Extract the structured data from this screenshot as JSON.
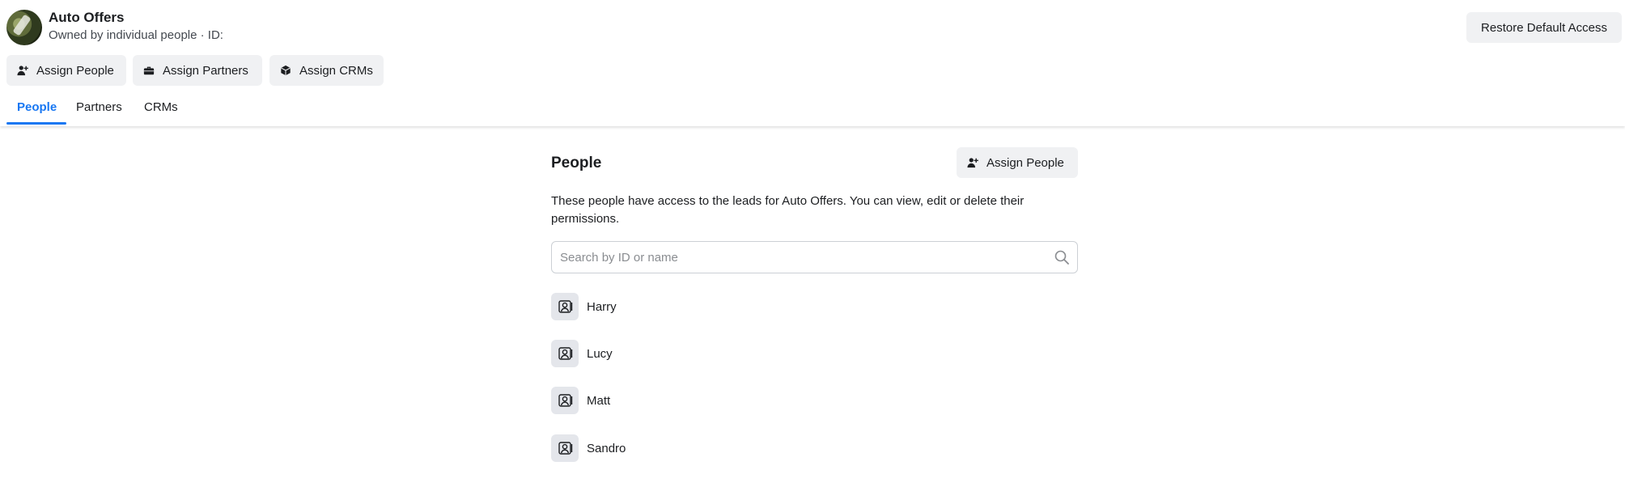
{
  "header": {
    "title": "Auto Offers",
    "subtitle": "Owned by individual people · ID:",
    "restore_label": "Restore Default Access"
  },
  "actions": {
    "assign_people": "Assign People",
    "assign_partners": "Assign Partners",
    "assign_crms": "Assign CRMs"
  },
  "tabs": [
    {
      "label": "People",
      "active": true
    },
    {
      "label": "Partners",
      "active": false
    },
    {
      "label": "CRMs",
      "active": false
    }
  ],
  "panel": {
    "title": "People",
    "assign_label": "Assign People",
    "description": "These people have access to the leads for Auto Offers. You can view, edit or delete their permissions.",
    "search_placeholder": "Search by ID or name",
    "people": [
      {
        "name": "Harry"
      },
      {
        "name": "Lucy"
      },
      {
        "name": "Matt"
      },
      {
        "name": "Sandro"
      }
    ]
  },
  "colors": {
    "accent": "#1877f2",
    "button_bg": "#f0f1f3"
  },
  "icons": {
    "avatar": "page-avatar",
    "assign_people": "person-add-icon",
    "assign_partners": "briefcase-icon",
    "assign_crms": "cube-icon",
    "search": "search-icon",
    "person": "person-id-icon"
  }
}
